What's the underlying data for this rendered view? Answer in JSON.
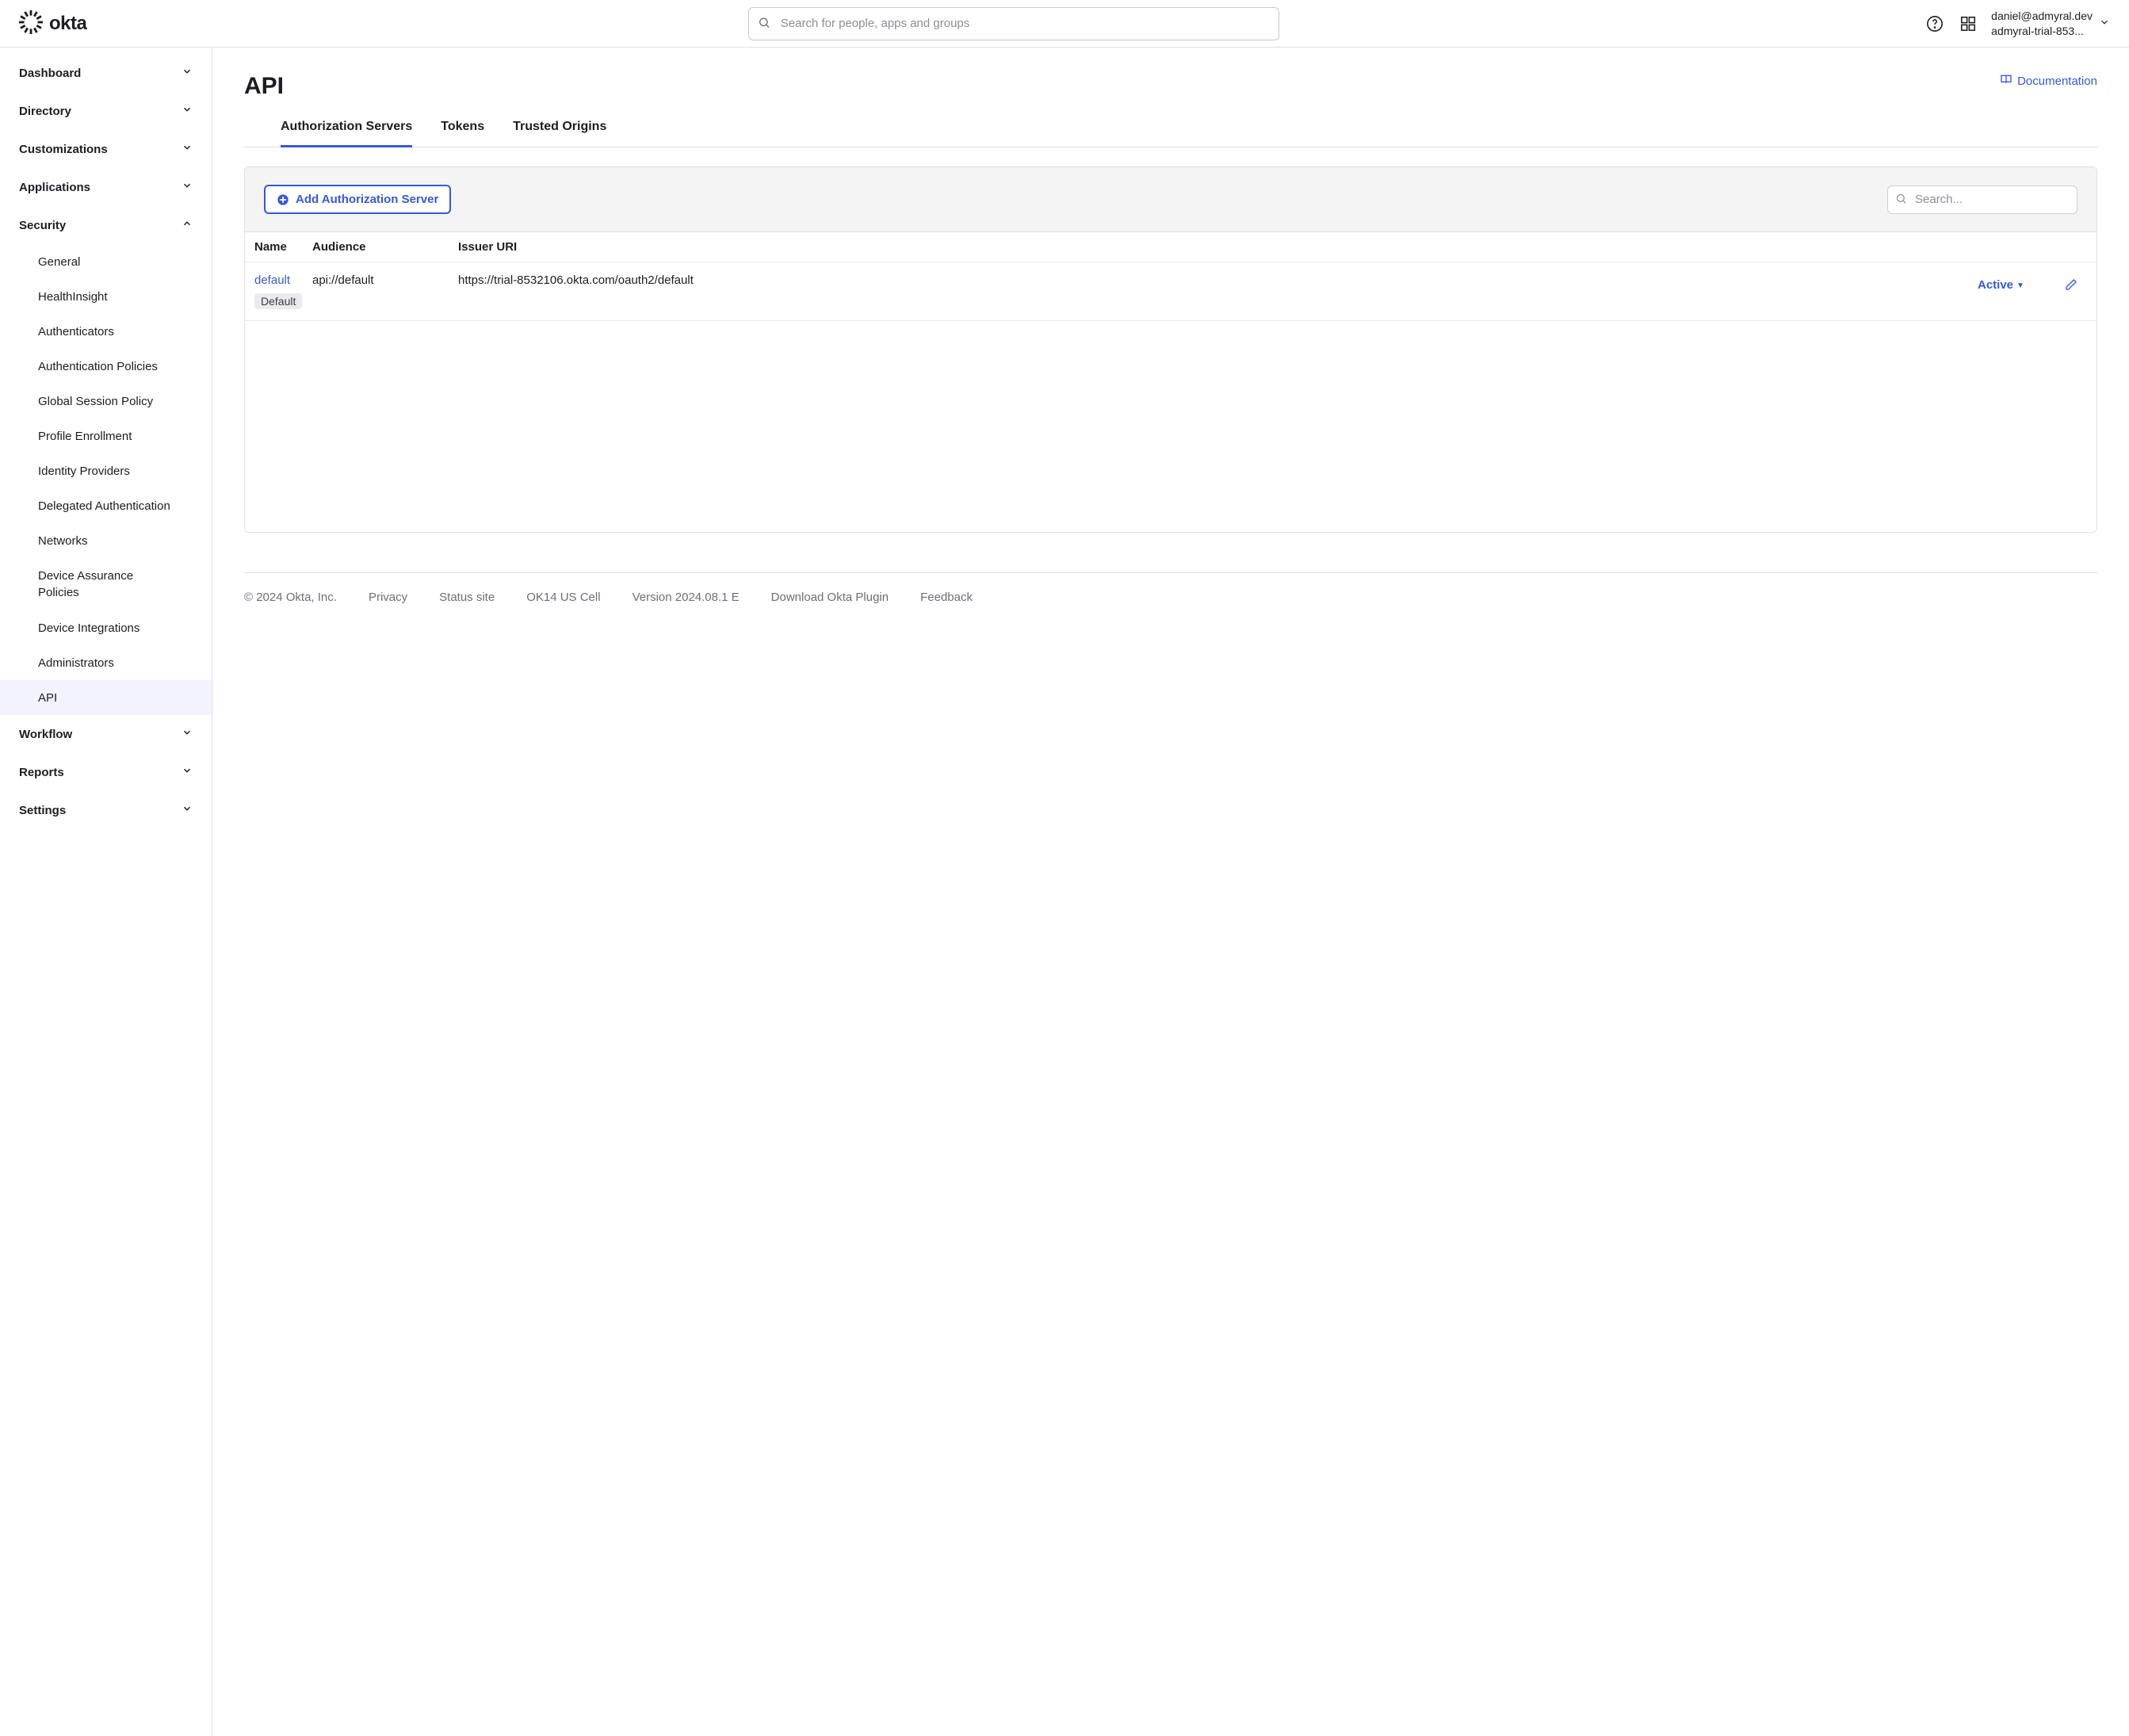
{
  "header": {
    "logo_text": "okta",
    "search_placeholder": "Search for people, apps and groups",
    "user_email": "daniel@admyral.dev",
    "user_org": "admyral-trial-853..."
  },
  "sidebar": {
    "items": [
      {
        "label": "Dashboard",
        "expanded": false
      },
      {
        "label": "Directory",
        "expanded": false
      },
      {
        "label": "Customizations",
        "expanded": false
      },
      {
        "label": "Applications",
        "expanded": false
      },
      {
        "label": "Security",
        "expanded": true,
        "children": [
          "General",
          "HealthInsight",
          "Authenticators",
          "Authentication Policies",
          "Global Session Policy",
          "Profile Enrollment",
          "Identity Providers",
          "Delegated Authentication",
          "Networks",
          "Device Assurance Policies",
          "Device Integrations",
          "Administrators",
          "API"
        ],
        "active_child": "API"
      },
      {
        "label": "Workflow",
        "expanded": false
      },
      {
        "label": "Reports",
        "expanded": false
      },
      {
        "label": "Settings",
        "expanded": false
      }
    ]
  },
  "page": {
    "title": "API",
    "doc_link": "Documentation",
    "tabs": [
      "Authorization Servers",
      "Tokens",
      "Trusted Origins"
    ],
    "active_tab": "Authorization Servers",
    "add_button": "Add Authorization Server",
    "table_search_placeholder": "Search...",
    "columns": {
      "name": "Name",
      "audience": "Audience",
      "issuer": "Issuer URI"
    },
    "rows": [
      {
        "name": "default",
        "default_badge": "Default",
        "audience": "api://default",
        "issuer": "https://trial-8532106.okta.com/oauth2/default",
        "status": "Active"
      }
    ]
  },
  "footer": {
    "copyright": "© 2024 Okta, Inc.",
    "privacy": "Privacy",
    "status": "Status site",
    "cell": "OK14 US Cell",
    "version": "Version 2024.08.1 E",
    "download": "Download Okta Plugin",
    "feedback": "Feedback"
  }
}
